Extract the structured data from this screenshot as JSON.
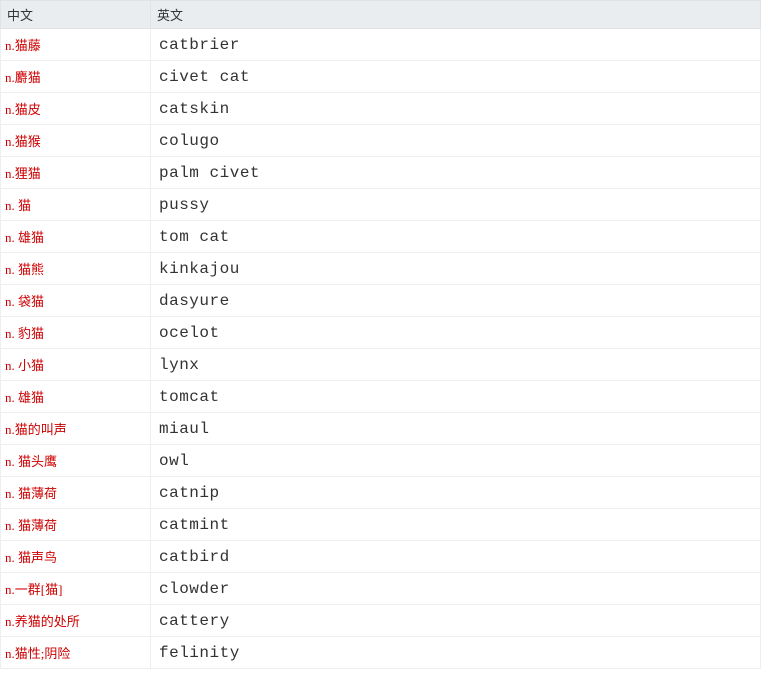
{
  "headers": {
    "cn": "中文",
    "en": "英文"
  },
  "rows": [
    {
      "pos": "n.",
      "cn": "猫藤",
      "en": "catbrier"
    },
    {
      "pos": "n.",
      "cn": "麝猫",
      "en": "civet cat"
    },
    {
      "pos": "n.",
      "cn": "猫皮",
      "en": "catskin"
    },
    {
      "pos": "n.",
      "cn": "猫猴",
      "en": "colugo"
    },
    {
      "pos": "n.",
      "cn": "狸猫",
      "en": "palm civet"
    },
    {
      "pos": "n.",
      "cn": " 猫",
      "en": "pussy"
    },
    {
      "pos": "n.",
      "cn": " 雄猫",
      "en": "tom cat"
    },
    {
      "pos": "n.",
      "cn": " 猫熊",
      "en": "kinkajou"
    },
    {
      "pos": "n.",
      "cn": " 袋猫",
      "en": "dasyure"
    },
    {
      "pos": "n.",
      "cn": " 豹猫",
      "en": "ocelot"
    },
    {
      "pos": "n.",
      "cn": " 小猫",
      "en": "lynx"
    },
    {
      "pos": "n.",
      "cn": " 雄猫",
      "en": "tomcat"
    },
    {
      "pos": "n.",
      "cn": "猫的叫声",
      "en": "miaul"
    },
    {
      "pos": "n.",
      "cn": " 猫头鹰",
      "en": "owl"
    },
    {
      "pos": "n.",
      "cn": " 猫薄荷",
      "en": "catnip"
    },
    {
      "pos": "n.",
      "cn": " 猫薄荷",
      "en": "catmint"
    },
    {
      "pos": "n.",
      "cn": " 猫声鸟",
      "en": "catbird"
    },
    {
      "pos": "n.",
      "cn": "一群[猫]",
      "en": "clowder"
    },
    {
      "pos": "n.",
      "cn": "养猫的处所",
      "en": "cattery"
    },
    {
      "pos": "n.",
      "cn": "猫性;阴险",
      "en": "felinity"
    }
  ]
}
